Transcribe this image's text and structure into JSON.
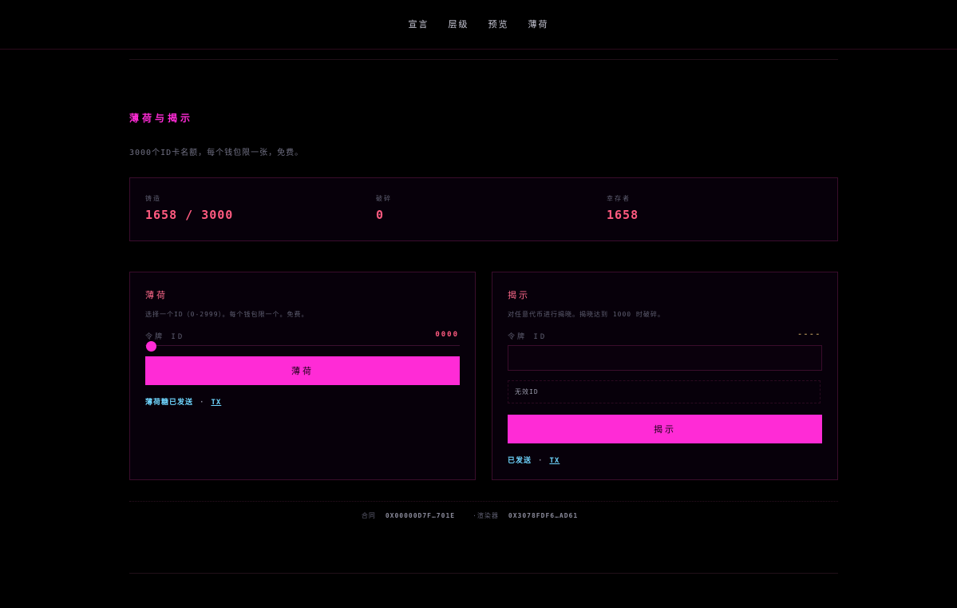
{
  "nav": {
    "items": [
      "宣言",
      "层级",
      "预览",
      "薄荷"
    ]
  },
  "section": {
    "title": "薄荷与揭示",
    "description": "3000个ID卡名额，每个钱包限一张，免费。"
  },
  "stats": [
    {
      "label": "铸造",
      "value": "1658 / 3000"
    },
    {
      "label": "破碎",
      "value": "0"
    },
    {
      "label": "幸存者",
      "value": "1658"
    }
  ],
  "mint": {
    "title": "薄荷",
    "description": "选择一个ID（0-2999）。每个钱包限一个。免费。",
    "field_label": "令牌 ID",
    "field_value": "0000",
    "slider_value": 0,
    "button": "薄荷",
    "status_text": "薄荷糖已发送",
    "tx": "TX"
  },
  "reveal": {
    "title": "揭示",
    "description": "对任意代币进行揭晓。揭晓达到 1000 时破碎。",
    "field_label": "令牌 ID",
    "field_value": "----",
    "input_value": "",
    "notice": "无效ID",
    "button": "揭示",
    "status_text": "已发送",
    "tx": "TX"
  },
  "footer": {
    "contract_label": "合同",
    "contract_value": "0X00000D7F…701E",
    "renderer_label": "·渲染器",
    "renderer_value": "0X3078FDF6…AD61"
  },
  "colors": {
    "accent": "#ff2bd6",
    "value": "#ff5a80",
    "link": "#6fd6ff",
    "background": "#000000"
  }
}
